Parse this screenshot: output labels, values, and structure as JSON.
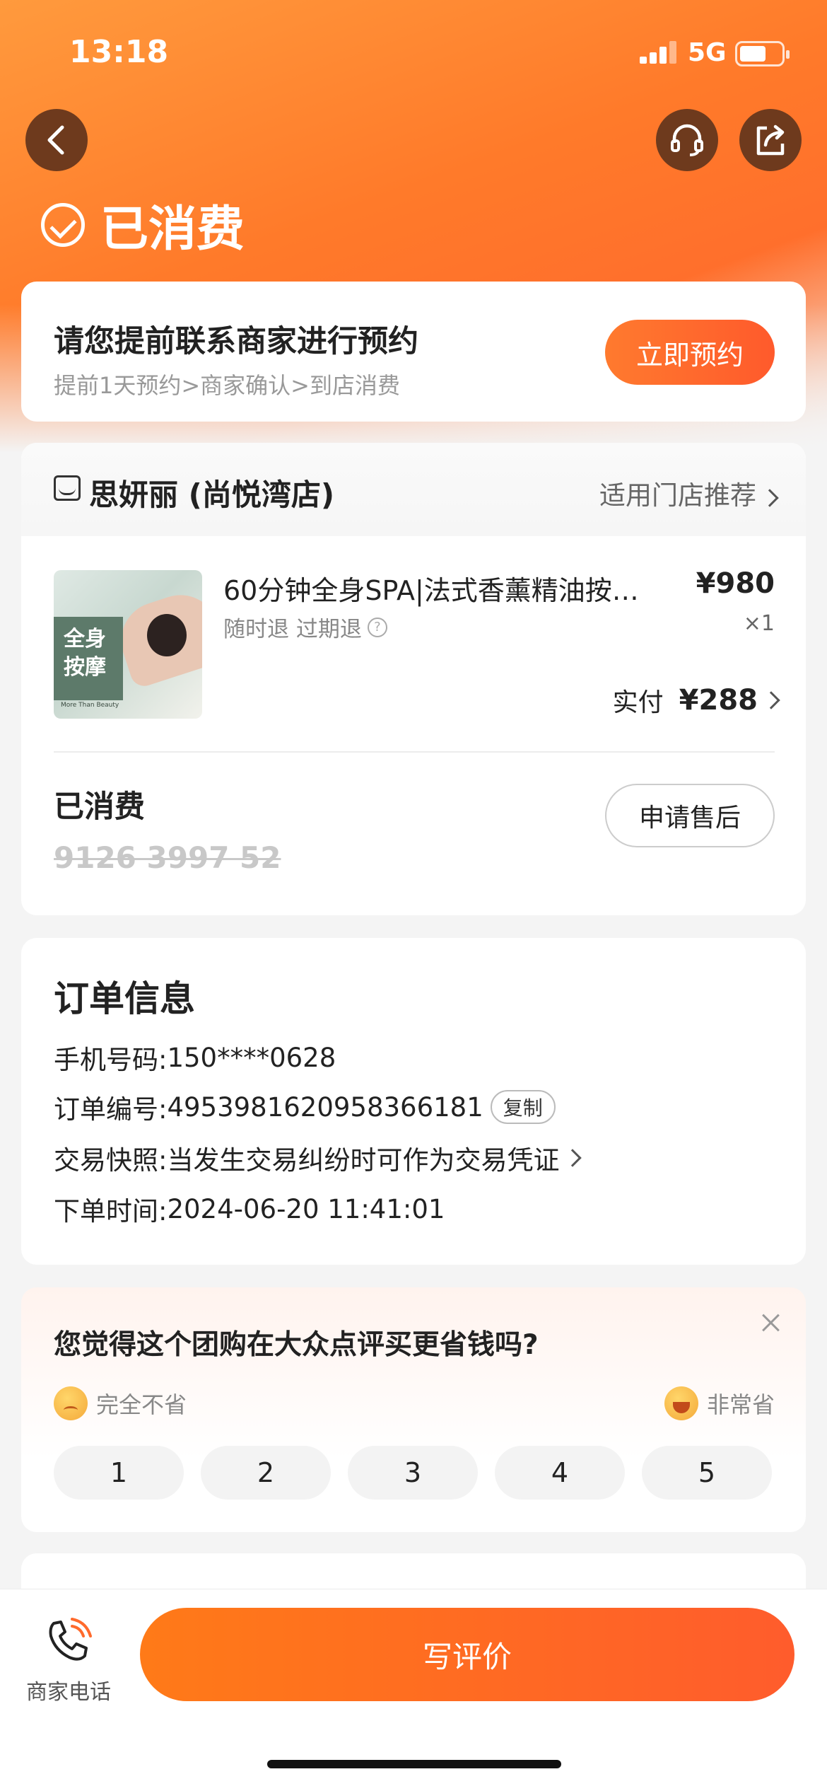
{
  "status_bar": {
    "time": "13:18",
    "network": "5G"
  },
  "nav": {
    "back_icon": "chevron-left-icon",
    "service_icon": "headset-icon",
    "share_icon": "share-icon"
  },
  "order_status": {
    "title": "已消费",
    "icon": "check-circle-icon"
  },
  "reservation": {
    "title": "请您提前联系商家进行预约",
    "steps": "提前1天预约>商家确认>到店消费",
    "button": "立即预约"
  },
  "shop": {
    "name": "思妍丽 (尚悦湾店)",
    "recommend_link": "适用门店推荐"
  },
  "product": {
    "image_tag": "全身按摩",
    "image_caption": "More Than Beauty",
    "title": "60分钟全身SPA|法式香薰精油按…",
    "policy": "随时退 过期退",
    "price": "¥980",
    "quantity": "×1",
    "paid_label": "实付",
    "paid_amount": "¥288"
  },
  "voucher": {
    "status": "已消费",
    "code": "9126 3997 52",
    "after_sale_button": "申请售后"
  },
  "order_info": {
    "heading": "订单信息",
    "phone_label": "手机号码:",
    "phone": "150****0628",
    "order_no_label": "订单编号:",
    "order_no": "4953981620958366181",
    "copy_button": "复制",
    "snapshot_label": "交易快照:",
    "snapshot_text": "当发生交易纠纷时可作为交易凭证",
    "time_label": "下单时间:",
    "time": "2024-06-20 11:41:01"
  },
  "survey": {
    "question": "您觉得这个团购在大众点评买更省钱吗?",
    "low_label": "完全不省",
    "high_label": "非常省",
    "options": [
      "1",
      "2",
      "3",
      "4",
      "5"
    ]
  },
  "bottom_bar": {
    "phone_label": "商家电话",
    "review_button": "写评价"
  },
  "colors": {
    "accent": "#ff6a2c",
    "brand_dark": "#6e3a1d"
  }
}
